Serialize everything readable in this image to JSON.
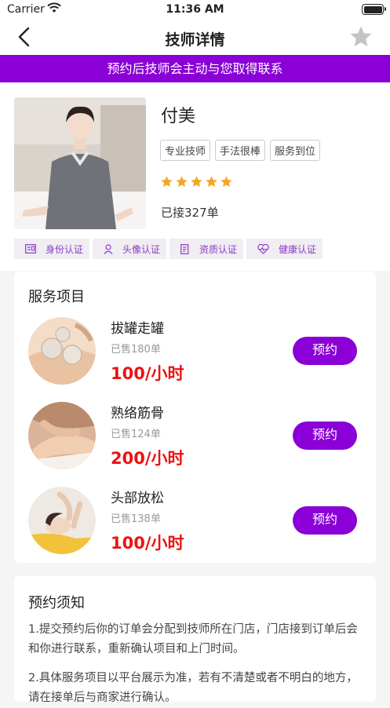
{
  "status_bar": {
    "carrier": "Carrier",
    "time": "11:36 AM"
  },
  "nav": {
    "title": "技师详情",
    "back_icon": "chevron-left-icon",
    "favorite_icon": "star-icon"
  },
  "banner": "预约后技师会主动与您取得联系",
  "tech": {
    "name": "付美",
    "tags": [
      "专业技师",
      "手法很棒",
      "服务到位"
    ],
    "rating": 5,
    "orders": "已接327单",
    "certs": [
      {
        "label": "身份认证",
        "icon": "id-card-icon"
      },
      {
        "label": "头像认证",
        "icon": "user-icon"
      },
      {
        "label": "资质认证",
        "icon": "document-icon"
      },
      {
        "label": "健康认证",
        "icon": "heart-icon"
      }
    ]
  },
  "services": {
    "title": "服务项目",
    "book_label": "预约",
    "items": [
      {
        "name": "拔罐走罐",
        "sold": "已售180单",
        "price": "100/小时"
      },
      {
        "name": "熟络筋骨",
        "sold": "已售124单",
        "price": "200/小时"
      },
      {
        "name": "头部放松",
        "sold": "已售138单",
        "price": "100/小时"
      }
    ]
  },
  "notice": {
    "title": "预约须知",
    "items": [
      "1.提交预约后你的订单会分配到技师所在门店，门店接到订单后会和你进行联系，重新确认项目和上门时间。",
      "2.具体服务项目以平台展示为准，若有不清楚或者不明白的地方，请在接单后与商家进行确认。"
    ]
  },
  "colors": {
    "accent": "#8a00d6",
    "price": "#ee1111",
    "star": "#f5a623"
  }
}
